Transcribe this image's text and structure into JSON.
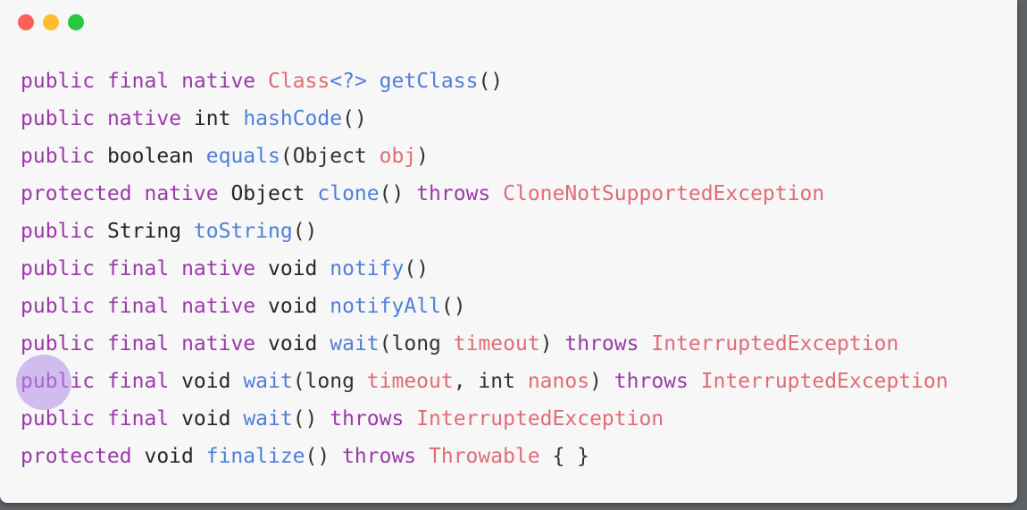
{
  "colors": {
    "close": "#ff5f57",
    "minimize": "#febc2e",
    "maximize": "#28c840",
    "keyword": "#9a3aa8",
    "function": "#4f7fd9",
    "class": "#e06c75",
    "plain": "#262626",
    "cursor_highlight": "#b28ceb"
  },
  "window_controls": [
    {
      "name": "close-button-icon",
      "color": "#ff5f57"
    },
    {
      "name": "minimize-button-icon",
      "color": "#febc2e"
    },
    {
      "name": "maximize-button-icon",
      "color": "#28c840"
    }
  ],
  "code_lines": [
    [
      [
        "kw",
        "public"
      ],
      [
        "pu",
        " "
      ],
      [
        "kw",
        "final"
      ],
      [
        "pu",
        " "
      ],
      [
        "kw",
        "native"
      ],
      [
        "pu",
        " "
      ],
      [
        "cl",
        "Class"
      ],
      [
        "fn",
        "<?>"
      ],
      [
        "pu",
        " "
      ],
      [
        "fn",
        "getClass"
      ],
      [
        "pu",
        "()"
      ]
    ],
    [
      [
        "kw",
        "public"
      ],
      [
        "pu",
        " "
      ],
      [
        "kw",
        "native"
      ],
      [
        "pu",
        " "
      ],
      [
        "ty",
        "int"
      ],
      [
        "pu",
        " "
      ],
      [
        "fn",
        "hashCode"
      ],
      [
        "pu",
        "()"
      ]
    ],
    [
      [
        "kw",
        "public"
      ],
      [
        "pu",
        " "
      ],
      [
        "ty",
        "boolean"
      ],
      [
        "pu",
        " "
      ],
      [
        "fn",
        "equals"
      ],
      [
        "pu",
        "(Object "
      ],
      [
        "pa",
        "obj"
      ],
      [
        "pu",
        ")"
      ]
    ],
    [
      [
        "kw",
        "protected"
      ],
      [
        "pu",
        " "
      ],
      [
        "kw",
        "native"
      ],
      [
        "pu",
        " "
      ],
      [
        "ty",
        "Object"
      ],
      [
        "pu",
        " "
      ],
      [
        "fn",
        "clone"
      ],
      [
        "pu",
        "() "
      ],
      [
        "kw",
        "throws"
      ],
      [
        "pu",
        " "
      ],
      [
        "cl",
        "CloneNotSupportedException"
      ]
    ],
    [
      [
        "kw",
        "public"
      ],
      [
        "pu",
        " "
      ],
      [
        "ty",
        "String"
      ],
      [
        "pu",
        " "
      ],
      [
        "fn",
        "toString"
      ],
      [
        "pu",
        "()"
      ]
    ],
    [
      [
        "kw",
        "public"
      ],
      [
        "pu",
        " "
      ],
      [
        "kw",
        "final"
      ],
      [
        "pu",
        " "
      ],
      [
        "kw",
        "native"
      ],
      [
        "pu",
        " "
      ],
      [
        "ty",
        "void"
      ],
      [
        "pu",
        " "
      ],
      [
        "fn",
        "notify"
      ],
      [
        "pu",
        "()"
      ]
    ],
    [
      [
        "kw",
        "public"
      ],
      [
        "pu",
        " "
      ],
      [
        "kw",
        "final"
      ],
      [
        "pu",
        " "
      ],
      [
        "kw",
        "native"
      ],
      [
        "pu",
        " "
      ],
      [
        "ty",
        "void"
      ],
      [
        "pu",
        " "
      ],
      [
        "fn",
        "notifyAll"
      ],
      [
        "pu",
        "()"
      ]
    ],
    [
      [
        "kw",
        "public"
      ],
      [
        "pu",
        " "
      ],
      [
        "kw",
        "final"
      ],
      [
        "pu",
        " "
      ],
      [
        "kw",
        "native"
      ],
      [
        "pu",
        " "
      ],
      [
        "ty",
        "void"
      ],
      [
        "pu",
        " "
      ],
      [
        "fn",
        "wait"
      ],
      [
        "pu",
        "(long "
      ],
      [
        "pa",
        "timeout"
      ],
      [
        "pu",
        ") "
      ],
      [
        "kw",
        "throws"
      ],
      [
        "pu",
        " "
      ],
      [
        "cl",
        "InterruptedException"
      ]
    ],
    [
      [
        "kw",
        "public"
      ],
      [
        "pu",
        " "
      ],
      [
        "kw",
        "final"
      ],
      [
        "pu",
        " "
      ],
      [
        "ty",
        "void"
      ],
      [
        "pu",
        " "
      ],
      [
        "fn",
        "wait"
      ],
      [
        "pu",
        "(long "
      ],
      [
        "pa",
        "timeout"
      ],
      [
        "pu",
        ", int "
      ],
      [
        "pa",
        "nanos"
      ],
      [
        "pu",
        ") "
      ],
      [
        "kw",
        "throws"
      ],
      [
        "pu",
        " "
      ],
      [
        "cl",
        "InterruptedException"
      ]
    ],
    [
      [
        "kw",
        "public"
      ],
      [
        "pu",
        " "
      ],
      [
        "kw",
        "final"
      ],
      [
        "pu",
        " "
      ],
      [
        "ty",
        "void"
      ],
      [
        "pu",
        " "
      ],
      [
        "fn",
        "wait"
      ],
      [
        "pu",
        "() "
      ],
      [
        "kw",
        "throws"
      ],
      [
        "pu",
        " "
      ],
      [
        "cl",
        "InterruptedException"
      ]
    ],
    [
      [
        "kw",
        "protected"
      ],
      [
        "pu",
        " "
      ],
      [
        "ty",
        "void"
      ],
      [
        "pu",
        " "
      ],
      [
        "fn",
        "finalize"
      ],
      [
        "pu",
        "() "
      ],
      [
        "kw",
        "throws"
      ],
      [
        "pu",
        " "
      ],
      [
        "cl",
        "Throwable"
      ],
      [
        "pu",
        " { }"
      ]
    ]
  ]
}
